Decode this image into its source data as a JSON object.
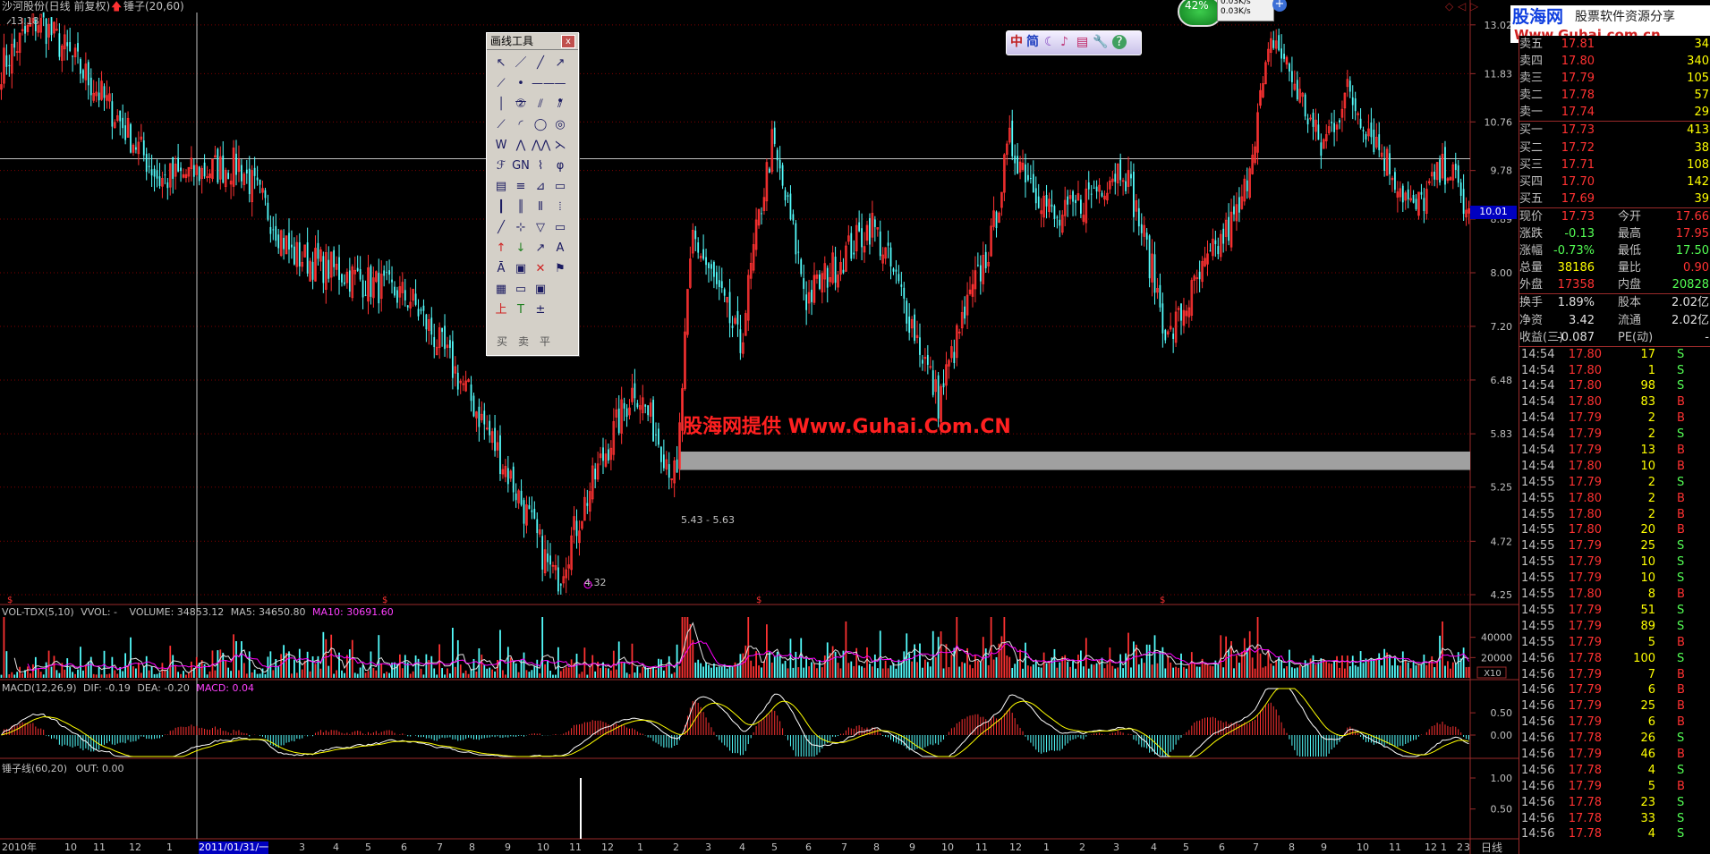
{
  "header": {
    "stock_title": "沙河股份(日线 前复权)",
    "formula_name": "锤子(20,60)",
    "max_price_label": "13.18",
    "min_price_label": "4.32",
    "zone_label": "5.43 - 5.63",
    "cursor_price": "10.01",
    "watermark": "股海网提供 Www.Guhai.Com.CN"
  },
  "brand": {
    "logo_cn": "股海网",
    "tagline": "股票软件资源分享",
    "url": "Www.Guhai.com.cn"
  },
  "speed_widget": {
    "percent": "42%",
    "up_rate": "0.03K/s",
    "down_rate": "0.03K/s"
  },
  "price_axis": [
    "13.02",
    "11.83",
    "10.76",
    "9.78",
    "8.89",
    "8.00",
    "7.20",
    "6.48",
    "5.83",
    "5.25",
    "4.72",
    "4.25"
  ],
  "volume_panel": {
    "label_prefix": "VOL-TDX(5,10)",
    "label_vvol": "VVOL: -",
    "label_volume": "VOLUME: 34853.12",
    "label_ma5": "MA5: 34650.80",
    "label_ma10": "MA10: 30691.60",
    "axis": [
      "40000",
      "20000"
    ],
    "unit": "X10"
  },
  "macd_panel": {
    "label_prefix": "MACD(12,26,9)",
    "label_dif": "DIF: -0.19",
    "label_dea": "DEA: -0.20",
    "label_macd": "MACD: 0.04",
    "axis": [
      "0.50",
      "0.00"
    ]
  },
  "hammer_panel": {
    "label": "锤子线(60,20)",
    "out_label": "OUT: 0.00",
    "axis": [
      "1.00",
      "0.50"
    ]
  },
  "date_axis": {
    "labels": [
      "2010年",
      "10",
      "11",
      "12",
      "1",
      "2011/01/31/一",
      "3",
      "4",
      "5",
      "6",
      "7",
      "8",
      "9",
      "10",
      "11",
      "12",
      "1",
      "2",
      "3",
      "4",
      "5",
      "6",
      "7",
      "8",
      "9",
      "10",
      "11",
      "12",
      "1",
      "2",
      "3",
      "4",
      "5",
      "6",
      "7",
      "8",
      "9",
      "10",
      "11",
      "12",
      "1",
      "2",
      "3"
    ],
    "period": "日线"
  },
  "quote": {
    "sell": [
      {
        "label": "卖五",
        "price": "17.81",
        "vol": "34"
      },
      {
        "label": "卖四",
        "price": "17.80",
        "vol": "340"
      },
      {
        "label": "卖三",
        "price": "17.79",
        "vol": "105"
      },
      {
        "label": "卖二",
        "price": "17.78",
        "vol": "57"
      },
      {
        "label": "卖一",
        "price": "17.74",
        "vol": "29"
      }
    ],
    "buy": [
      {
        "label": "买一",
        "price": "17.73",
        "vol": "413"
      },
      {
        "label": "买二",
        "price": "17.72",
        "vol": "38"
      },
      {
        "label": "买三",
        "price": "17.71",
        "vol": "108"
      },
      {
        "label": "买四",
        "price": "17.70",
        "vol": "142"
      },
      {
        "label": "买五",
        "price": "17.69",
        "vol": "39"
      }
    ],
    "stats": [
      {
        "l1": "现价",
        "v1": "17.73",
        "l2": "今开",
        "v2": "17.66"
      },
      {
        "l1": "涨跌",
        "v1": "-0.13",
        "l2": "最高",
        "v2": "17.95"
      },
      {
        "l1": "涨幅",
        "v1": "-0.73%",
        "l2": "最低",
        "v2": "17.50"
      },
      {
        "l1": "总量",
        "v1": "38186",
        "l2": "量比",
        "v2": "0.90"
      },
      {
        "l1": "外盘",
        "v1": "17358",
        "l2": "内盘",
        "v2": "20828"
      }
    ],
    "fund": [
      {
        "l1": "换手",
        "v1": "1.89%",
        "l2": "股本",
        "v2": "2.02亿"
      },
      {
        "l1": "净资",
        "v1": "3.42",
        "l2": "流通",
        "v2": "2.02亿"
      },
      {
        "l1": "收益(三)",
        "v1": "-0.087",
        "l2": "PE(动)",
        "v2": "-"
      }
    ],
    "ticks": [
      {
        "t": "14:54",
        "p": "17.80",
        "v": "17",
        "s": "S"
      },
      {
        "t": "14:54",
        "p": "17.80",
        "v": "1",
        "s": "S"
      },
      {
        "t": "14:54",
        "p": "17.80",
        "v": "98",
        "s": "S"
      },
      {
        "t": "14:54",
        "p": "17.80",
        "v": "83",
        "s": "B"
      },
      {
        "t": "14:54",
        "p": "17.79",
        "v": "2",
        "s": "B"
      },
      {
        "t": "14:54",
        "p": "17.79",
        "v": "2",
        "s": "S"
      },
      {
        "t": "14:54",
        "p": "17.79",
        "v": "13",
        "s": "B"
      },
      {
        "t": "14:54",
        "p": "17.80",
        "v": "10",
        "s": "B"
      },
      {
        "t": "14:55",
        "p": "17.79",
        "v": "2",
        "s": "S"
      },
      {
        "t": "14:55",
        "p": "17.80",
        "v": "2",
        "s": "B"
      },
      {
        "t": "14:55",
        "p": "17.80",
        "v": "2",
        "s": "B"
      },
      {
        "t": "14:55",
        "p": "17.80",
        "v": "20",
        "s": "B"
      },
      {
        "t": "14:55",
        "p": "17.79",
        "v": "25",
        "s": "S"
      },
      {
        "t": "14:55",
        "p": "17.79",
        "v": "10",
        "s": "S"
      },
      {
        "t": "14:55",
        "p": "17.79",
        "v": "10",
        "s": "S"
      },
      {
        "t": "14:55",
        "p": "17.80",
        "v": "8",
        "s": "B"
      },
      {
        "t": "14:55",
        "p": "17.79",
        "v": "51",
        "s": "S"
      },
      {
        "t": "14:55",
        "p": "17.79",
        "v": "89",
        "s": "S"
      },
      {
        "t": "14:55",
        "p": "17.79",
        "v": "5",
        "s": "B"
      },
      {
        "t": "14:56",
        "p": "17.78",
        "v": "100",
        "s": "S"
      },
      {
        "t": "14:56",
        "p": "17.79",
        "v": "7",
        "s": "B"
      },
      {
        "t": "14:56",
        "p": "17.79",
        "v": "6",
        "s": "B"
      },
      {
        "t": "14:56",
        "p": "17.79",
        "v": "25",
        "s": "B"
      },
      {
        "t": "14:56",
        "p": "17.79",
        "v": "6",
        "s": "B"
      },
      {
        "t": "14:56",
        "p": "17.78",
        "v": "26",
        "s": "S"
      },
      {
        "t": "14:56",
        "p": "17.79",
        "v": "46",
        "s": "B"
      },
      {
        "t": "14:56",
        "p": "17.78",
        "v": "4",
        "s": "S"
      },
      {
        "t": "14:56",
        "p": "17.79",
        "v": "5",
        "s": "B"
      },
      {
        "t": "14:56",
        "p": "17.78",
        "v": "23",
        "s": "S"
      },
      {
        "t": "14:56",
        "p": "17.78",
        "v": "33",
        "s": "S"
      },
      {
        "t": "14:56",
        "p": "17.78",
        "v": "4",
        "s": "S"
      }
    ]
  },
  "toolbox": {
    "title": "画线工具",
    "close": "x",
    "trade_buy": "买",
    "trade_sell": "卖",
    "trade_flat": "平",
    "icons": [
      "cursor-icon",
      "line-icon",
      "ray-icon",
      "arrow-line-icon",
      "segment-icon",
      "h-ray-icon",
      "h-line-icon",
      "h-segment-icon",
      "vertical-line-icon",
      "numbered-wave-icon",
      "parallel-icon",
      "channel-icon",
      "regression-icon",
      "arc-icon",
      "circle-icon",
      "ellipse-icon",
      "wave-w-icon",
      "zigzag-icon",
      "m-wave-icon",
      "fan-line-icon",
      "fibonacci-icon",
      "gann-icon",
      "speed-line-icon",
      "golden-icon",
      "percent-line-icon",
      "resistance-icon",
      "gann-fan-icon",
      "box-icon",
      "period-line-icon",
      "time-line-icon",
      "fib-time-icon",
      "cycle-icon",
      "label-icon",
      "cross-icon",
      "triangle-icon",
      "rectangle-icon",
      "up-arrow-icon",
      "down-arrow-icon",
      "mark-icon",
      "text-icon",
      "text-note-icon",
      "select-icon",
      "delete-icon",
      "flag-icon",
      "save-icon",
      "hide-icon",
      "group-icon",
      "",
      "buy-mark-icon",
      "sell-mark-icon",
      "flat-mark-icon",
      ""
    ],
    "icon_glyphs": [
      "↖",
      "／",
      "╱",
      "↗",
      "⟋",
      "•—",
      "——",
      "—•",
      "│",
      "②",
      "⫽",
      "⫽",
      "⟋",
      "◜",
      "◯",
      "◎",
      "W",
      "⋀",
      "⋀⋀",
      "⋋",
      "ℱ",
      "GN",
      "⌇",
      "φ",
      "▤",
      "≡",
      "⊿",
      "▭",
      "┃",
      "║",
      "⦀",
      "⦙",
      "╱",
      "⊹",
      "▽",
      "▭",
      "↑",
      "↓",
      "↗",
      "A",
      "Ā",
      "▣",
      "✕",
      "⚑",
      "▦",
      "▭",
      "▣",
      "",
      "上",
      "T",
      "±",
      ""
    ]
  },
  "colors": {
    "up": "#ff3232",
    "down": "#54ffff",
    "gold": "#ffff00",
    "grid": "#800000",
    "axis_text": "#c0c0c0",
    "magenta": "#ff00ff"
  },
  "chart_data": {
    "type": "candlestick",
    "ylim": [
      4.25,
      13.2
    ],
    "segments": [
      {
        "start": 0,
        "end": 14,
        "from": 12.0,
        "to": 13.18
      },
      {
        "start": 14,
        "end": 60,
        "from": 13.18,
        "to": 9.6
      },
      {
        "start": 60,
        "end": 90,
        "from": 9.6,
        "to": 9.9
      },
      {
        "start": 90,
        "end": 110,
        "from": 9.9,
        "to": 8.3
      },
      {
        "start": 110,
        "end": 155,
        "from": 8.3,
        "to": 7.6
      },
      {
        "start": 155,
        "end": 210,
        "from": 7.6,
        "to": 4.32
      },
      {
        "start": 210,
        "end": 240,
        "from": 4.32,
        "to": 6.4
      },
      {
        "start": 240,
        "end": 256,
        "from": 6.4,
        "to": 5.3
      },
      {
        "start": 256,
        "end": 262,
        "from": 5.3,
        "to": 8.6
      },
      {
        "start": 262,
        "end": 280,
        "from": 8.6,
        "to": 6.9
      },
      {
        "start": 280,
        "end": 292,
        "from": 6.9,
        "to": 10.3
      },
      {
        "start": 292,
        "end": 305,
        "from": 10.3,
        "to": 7.6
      },
      {
        "start": 305,
        "end": 330,
        "from": 7.6,
        "to": 8.8
      },
      {
        "start": 330,
        "end": 355,
        "from": 8.8,
        "to": 6.2
      },
      {
        "start": 355,
        "end": 375,
        "from": 6.2,
        "to": 8.5
      },
      {
        "start": 375,
        "end": 382,
        "from": 8.5,
        "to": 10.3
      },
      {
        "start": 382,
        "end": 400,
        "from": 10.3,
        "to": 8.8
      },
      {
        "start": 400,
        "end": 425,
        "from": 8.8,
        "to": 9.9
      },
      {
        "start": 425,
        "end": 442,
        "from": 9.9,
        "to": 7.0
      },
      {
        "start": 442,
        "end": 470,
        "from": 7.0,
        "to": 9.1
      },
      {
        "start": 470,
        "end": 482,
        "from": 9.1,
        "to": 12.7
      },
      {
        "start": 482,
        "end": 500,
        "from": 12.7,
        "to": 10.2
      },
      {
        "start": 500,
        "end": 510,
        "from": 10.2,
        "to": 11.4
      },
      {
        "start": 510,
        "end": 535,
        "from": 11.4,
        "to": 9.0
      },
      {
        "start": 535,
        "end": 548,
        "from": 9.0,
        "to": 9.9
      },
      {
        "start": 548,
        "end": 556,
        "from": 9.9,
        "to": 8.9
      }
    ]
  }
}
